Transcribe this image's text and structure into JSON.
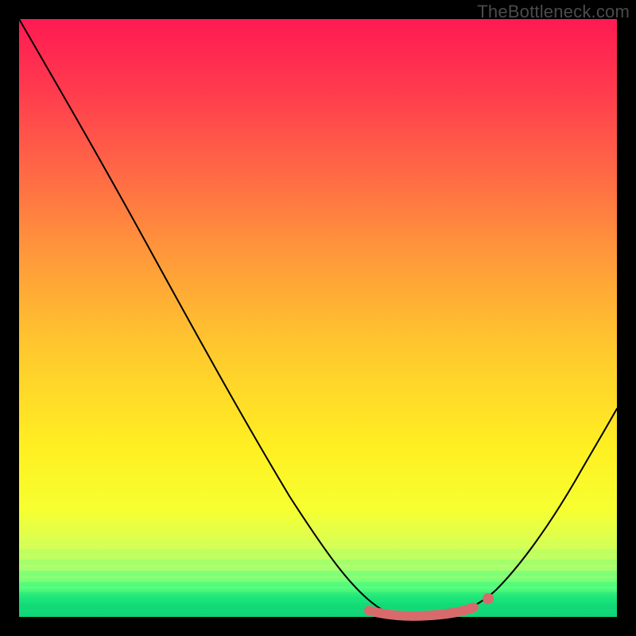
{
  "watermark": "TheBottleneck.com",
  "chart_data": {
    "type": "line",
    "title": "",
    "xlabel": "",
    "ylabel": "",
    "xlim": [
      0,
      100
    ],
    "ylim": [
      0,
      100
    ],
    "background": {
      "style": "vertical-gradient",
      "meaning": "top = worst (red), bottom = best (green)",
      "stops": [
        {
          "pos": 0,
          "color": "#ff1a52"
        },
        {
          "pos": 50,
          "color": "#ffd42c"
        },
        {
          "pos": 85,
          "color": "#f6ff30"
        },
        {
          "pos": 100,
          "color": "#0fd477"
        }
      ]
    },
    "series": [
      {
        "name": "bottleneck-curve",
        "color": "#000000",
        "x": [
          0,
          5,
          10,
          15,
          20,
          25,
          30,
          35,
          40,
          45,
          50,
          55,
          58,
          62,
          66,
          70,
          74,
          78,
          82,
          86,
          90,
          94,
          98,
          100
        ],
        "values": [
          100,
          92,
          83,
          75,
          66,
          57,
          48,
          40,
          31,
          23,
          16,
          10,
          6,
          2,
          0.5,
          0,
          0.3,
          1,
          3,
          7,
          12,
          19,
          28,
          33
        ]
      }
    ],
    "highlight": {
      "name": "optimal-range",
      "color": "#d86a6c",
      "x_range": [
        58,
        76
      ],
      "y_approx": 0.5,
      "marker_at_x": 78
    },
    "grid": false,
    "legend": false
  }
}
